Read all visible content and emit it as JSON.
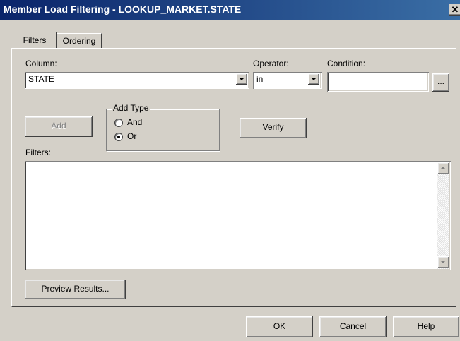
{
  "window": {
    "title": "Member Load Filtering - LOOKUP_MARKET.STATE",
    "close_glyph": "✕"
  },
  "tabs": [
    {
      "label": "Filters"
    },
    {
      "label": "Ordering"
    }
  ],
  "column": {
    "label": "Column:",
    "value": "STATE"
  },
  "operator": {
    "label": "Operator:",
    "value": "in"
  },
  "condition": {
    "label": "Condition:",
    "value": "",
    "browse_label": "..."
  },
  "add_button": {
    "label": "Add",
    "enabled": false
  },
  "add_type": {
    "title": "Add Type",
    "options": [
      {
        "label": "And",
        "selected": false
      },
      {
        "label": "Or",
        "selected": true
      }
    ]
  },
  "verify_button": {
    "label": "Verify"
  },
  "filters": {
    "label": "Filters:",
    "items": []
  },
  "preview_button": {
    "label": "Preview Results..."
  },
  "footer": {
    "ok": "OK",
    "cancel": "Cancel",
    "help": "Help"
  },
  "colors": {
    "title_start": "#0a246a",
    "title_end": "#3a6ea5",
    "face": "#d4d0c8"
  },
  "icons": [
    "close-icon",
    "dropdown-arrow-icon",
    "scroll-up-icon",
    "scroll-down-icon"
  ]
}
